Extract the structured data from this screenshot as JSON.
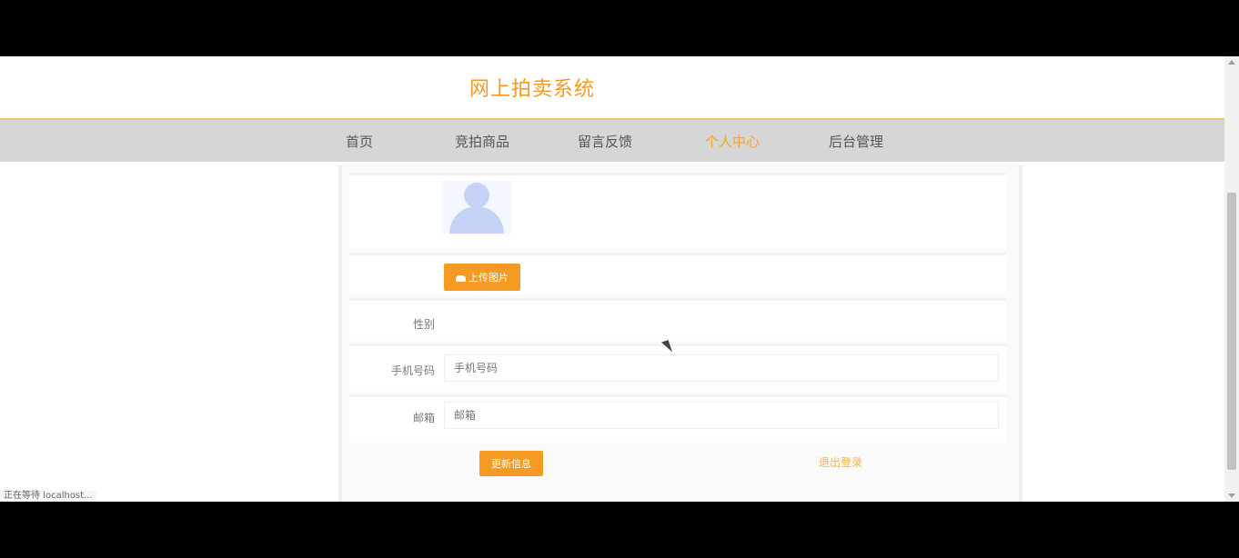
{
  "site": {
    "title": "网上拍卖系统"
  },
  "nav": {
    "items": [
      {
        "label": "首页"
      },
      {
        "label": "竞拍商品"
      },
      {
        "label": "留言反馈"
      },
      {
        "label": "个人中心"
      },
      {
        "label": "后台管理"
      }
    ],
    "active_index": 3
  },
  "profile": {
    "upload_label": "上传图片",
    "gender_label": "性别",
    "gender_value": "",
    "phone_label": "手机号码",
    "phone_placeholder": "手机号码",
    "email_label": "邮箱",
    "email_placeholder": "邮箱",
    "update_label": "更新信息",
    "logout_label": "退出登录"
  },
  "status_bar": {
    "text": "正在等待 localhost..."
  },
  "colors": {
    "accent": "#f59a23",
    "nav_bg": "#d6d6d6",
    "active_nav": "#f5a623"
  }
}
